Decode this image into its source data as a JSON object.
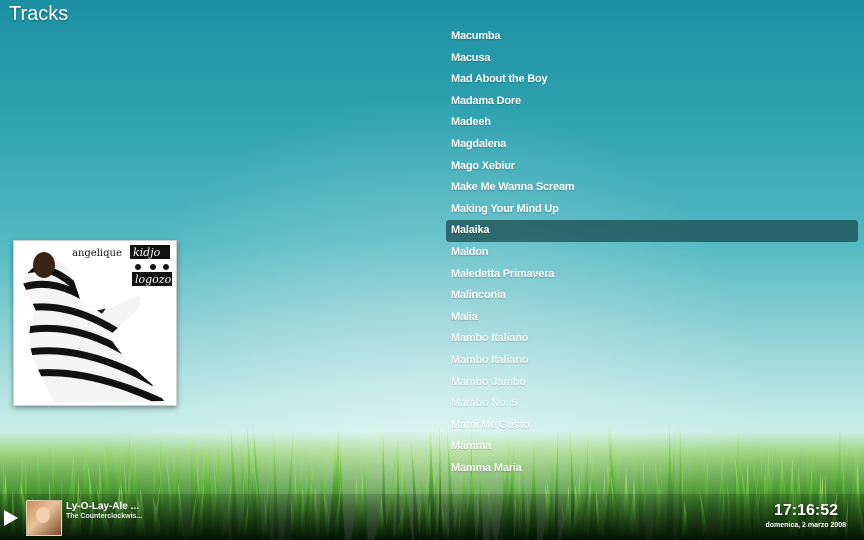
{
  "header": {
    "title": "Tracks"
  },
  "tracks": [
    {
      "label": "Macumba",
      "opacity": 1
    },
    {
      "label": "Macusa",
      "opacity": 1
    },
    {
      "label": "Mad About the Boy",
      "opacity": 1
    },
    {
      "label": "Madama Dore",
      "opacity": 1
    },
    {
      "label": "Madeeh",
      "opacity": 1
    },
    {
      "label": "Magdalena",
      "opacity": 1
    },
    {
      "label": "Mago Xebiur",
      "opacity": 1
    },
    {
      "label": "Make Me Wanna Scream",
      "opacity": 1
    },
    {
      "label": "Making Your Mind Up",
      "opacity": 1
    },
    {
      "label": "Malaika",
      "opacity": 1,
      "selected": true
    },
    {
      "label": "Maldon",
      "opacity": 1
    },
    {
      "label": "Maledetta Primavera",
      "opacity": 1
    },
    {
      "label": "Malinconia",
      "opacity": 1
    },
    {
      "label": "Malia",
      "opacity": 1
    },
    {
      "label": "Mambo Italiano",
      "opacity": 0.9
    },
    {
      "label": "Mambo Italiano",
      "opacity": 0.75
    },
    {
      "label": "Mambo Jambo",
      "opacity": 0.6
    },
    {
      "label": "Mambo No. 5",
      "opacity": 0.5
    },
    {
      "label": "Mami Me Gusto",
      "opacity": 0.6
    },
    {
      "label": "Mamma",
      "opacity": 0.85
    },
    {
      "label": "Mamma Maria",
      "opacity": 1
    }
  ],
  "album_art": {
    "artist_text": "angelique",
    "name_text": "kidjo",
    "album_text": "logozo"
  },
  "now_playing": {
    "title": "Ly-O-Lay-Ale ...",
    "artist": "The Counterclockwis..."
  },
  "clock": {
    "time": "17:16:52",
    "date": "domenica, 2 marzo 2008"
  },
  "icons": {
    "play": "play-icon"
  },
  "colors": {
    "selected_row": "#16464b",
    "text": "#ffffff"
  }
}
